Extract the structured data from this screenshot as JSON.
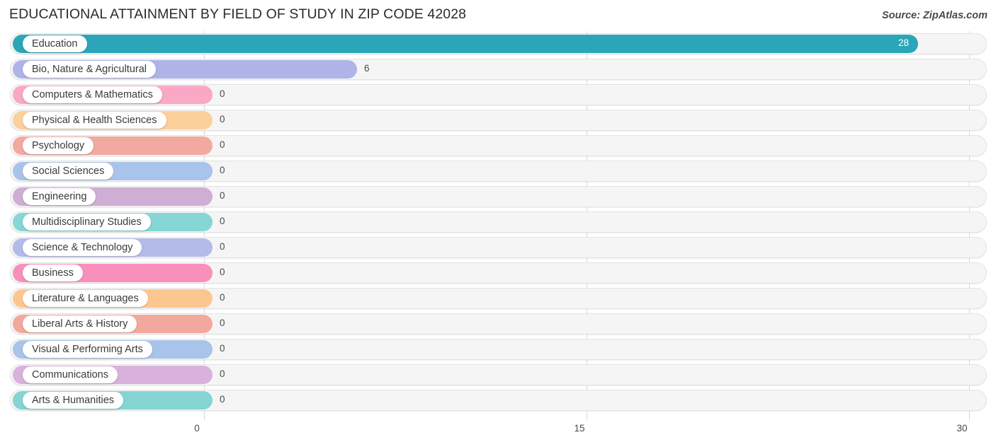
{
  "header": {
    "title": "EDUCATIONAL ATTAINMENT BY FIELD OF STUDY IN ZIP CODE 42028",
    "source": "Source: ZipAtlas.com"
  },
  "chart_data": {
    "type": "bar",
    "orientation": "horizontal",
    "title": "EDUCATIONAL ATTAINMENT BY FIELD OF STUDY IN ZIP CODE 42028",
    "xlabel": "",
    "ylabel": "",
    "xlim": [
      0,
      30
    ],
    "xticks": [
      0,
      15,
      30
    ],
    "xtick_labels": [
      "0",
      "15",
      "30"
    ],
    "grid": true,
    "legend": false,
    "categories": [
      "Education",
      "Bio, Nature & Agricultural",
      "Computers & Mathematics",
      "Physical & Health Sciences",
      "Psychology",
      "Social Sciences",
      "Engineering",
      "Multidisciplinary Studies",
      "Science & Technology",
      "Business",
      "Literature & Languages",
      "Liberal Arts & History",
      "Visual & Performing Arts",
      "Communications",
      "Arts & Humanities"
    ],
    "values": [
      28,
      6,
      0,
      0,
      0,
      0,
      0,
      0,
      0,
      0,
      0,
      0,
      0,
      0,
      0
    ],
    "value_labels": [
      "28",
      "6",
      "0",
      "0",
      "0",
      "0",
      "0",
      "0",
      "0",
      "0",
      "0",
      "0",
      "0",
      "0",
      "0"
    ],
    "colors": [
      "#2ba6b8",
      "#aeb4e8",
      "#f9a8c6",
      "#fcd09a",
      "#f2a9a0",
      "#a8c4ea",
      "#ceaed4",
      "#86d6d6",
      "#b4bbe8",
      "#f98fbb",
      "#fcc78f",
      "#f3a89d",
      "#a8c4ea",
      "#d8b2dd",
      "#85d4d4"
    ]
  }
}
